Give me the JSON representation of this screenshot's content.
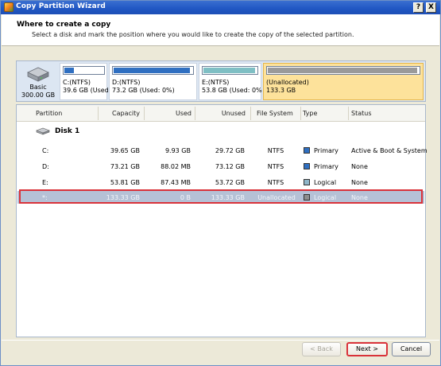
{
  "window": {
    "title": "Copy Partition Wizard",
    "help_label": "?",
    "close_label": "X"
  },
  "header": {
    "title": "Where to create a copy",
    "subtitle": "Select a disk and mark the position where you would like to create the copy of the selected partition."
  },
  "disk_map": {
    "disk_label": "Basic",
    "disk_size": "300.00 GB",
    "partitions": [
      {
        "name": "C:(NTFS)",
        "detail": "39.6 GB (Used",
        "fill_fraction": 0.25,
        "bar_color": "#2f6fc1",
        "selected": false
      },
      {
        "name": "D:(NTFS)",
        "detail": "73.2 GB (Used: 0%)",
        "fill_fraction": 0.97,
        "bar_color": "#2f6fc1",
        "selected": false
      },
      {
        "name": "E:(NTFS)",
        "detail": "53.8 GB (Used: 0%",
        "fill_fraction": 0.97,
        "bar_color": "#7fbfc4",
        "selected": false
      },
      {
        "name": "(Unallocated)",
        "detail": "133.3 GB",
        "fill_fraction": 0.99,
        "bar_color": "#9a9a9a",
        "selected": true
      }
    ]
  },
  "table": {
    "headers": [
      "Partition",
      "Capacity",
      "Used",
      "Unused",
      "File System",
      "Type",
      "Status"
    ],
    "disk_name": "Disk 1",
    "rows": [
      {
        "partition": "C:",
        "capacity": "39.65 GB",
        "used": "9.93 GB",
        "unused": "29.72 GB",
        "fs": "NTFS",
        "type": "Primary",
        "type_color": "#2f6fc1",
        "status": "Active & Boot & System"
      },
      {
        "partition": "D:",
        "capacity": "73.21 GB",
        "used": "88.02 MB",
        "unused": "73.12 GB",
        "fs": "NTFS",
        "type": "Primary",
        "type_color": "#2f6fc1",
        "status": "None"
      },
      {
        "partition": "E:",
        "capacity": "53.81 GB",
        "used": "87.43 MB",
        "unused": "53.72 GB",
        "fs": "NTFS",
        "type": "Logical",
        "type_color": "#8fb6c9",
        "status": "None"
      },
      {
        "partition": "*:",
        "capacity": "133.33 GB",
        "used": "0 B",
        "unused": "133.33 GB",
        "fs": "Unallocated",
        "type": "Logical",
        "type_color": "#8e8e8e",
        "status": "None"
      }
    ]
  },
  "buttons": {
    "back": "< Back",
    "next": "Next >",
    "cancel": "Cancel"
  },
  "colors": {
    "titlebar": "#2056c3",
    "highlight_box": "#d9323a",
    "selected_row": "#b5c1d6",
    "selected_partition": "#fde29b"
  }
}
